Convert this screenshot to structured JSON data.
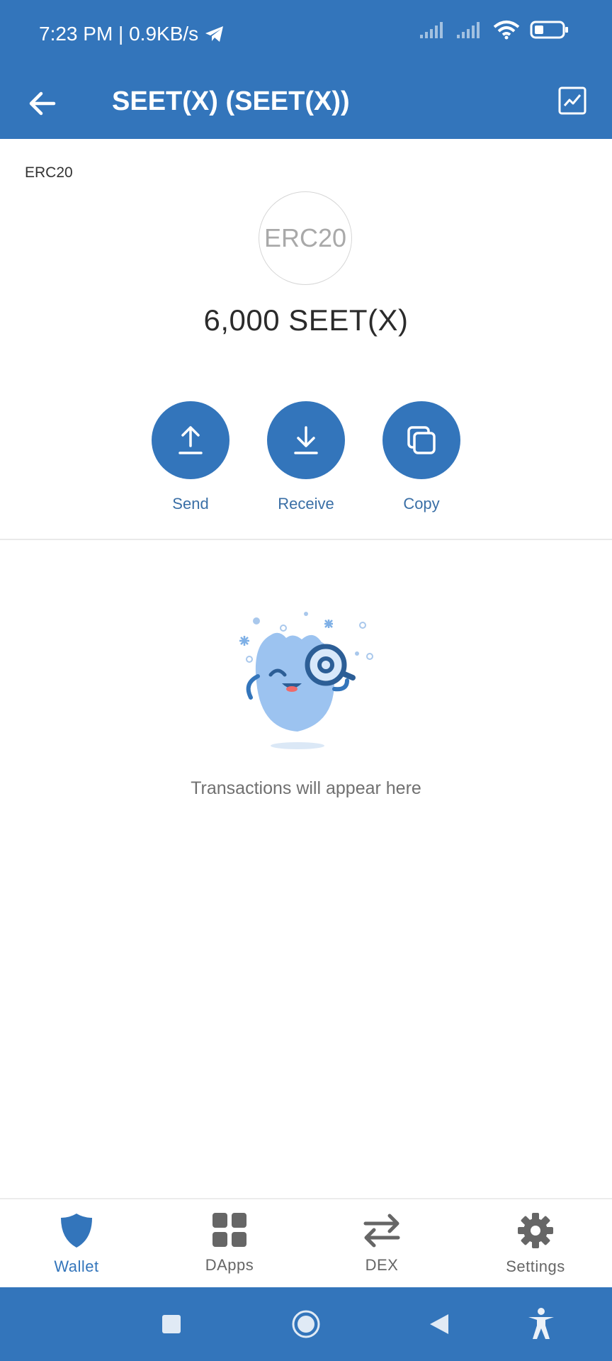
{
  "status_bar": {
    "time_and_speed": "7:23 PM | 0.9KB/s",
    "icons": [
      "telegram-icon",
      "signal-icon",
      "signal-icon",
      "wifi-icon",
      "battery-icon"
    ]
  },
  "app_bar": {
    "title": "SEET(X) (SEET(X))",
    "back_icon": "back-arrow-icon",
    "chart_icon": "chart-icon"
  },
  "token": {
    "type_label": "ERC20",
    "logo_text": "ERC20",
    "balance": "6,000 SEET(X)"
  },
  "actions": [
    {
      "label": "Send",
      "icon": "upload-icon"
    },
    {
      "label": "Receive",
      "icon": "download-icon"
    },
    {
      "label": "Copy",
      "icon": "copy-icon"
    }
  ],
  "empty_state": {
    "message": "Transactions will appear here",
    "illustration": "magnifier-mascot"
  },
  "bottom_nav": {
    "active": "Wallet",
    "items": [
      {
        "label": "Wallet",
        "icon": "shield-icon"
      },
      {
        "label": "DApps",
        "icon": "grid-icon"
      },
      {
        "label": "DEX",
        "icon": "swap-icon"
      },
      {
        "label": "Settings",
        "icon": "gear-icon"
      }
    ]
  },
  "system_nav": {
    "icons": [
      "square-icon",
      "circle-icon",
      "triangle-back-icon",
      "accessibility-icon"
    ]
  },
  "colors": {
    "primary": "#3375bb",
    "background": "#ffffff",
    "text_muted": "#707070"
  }
}
